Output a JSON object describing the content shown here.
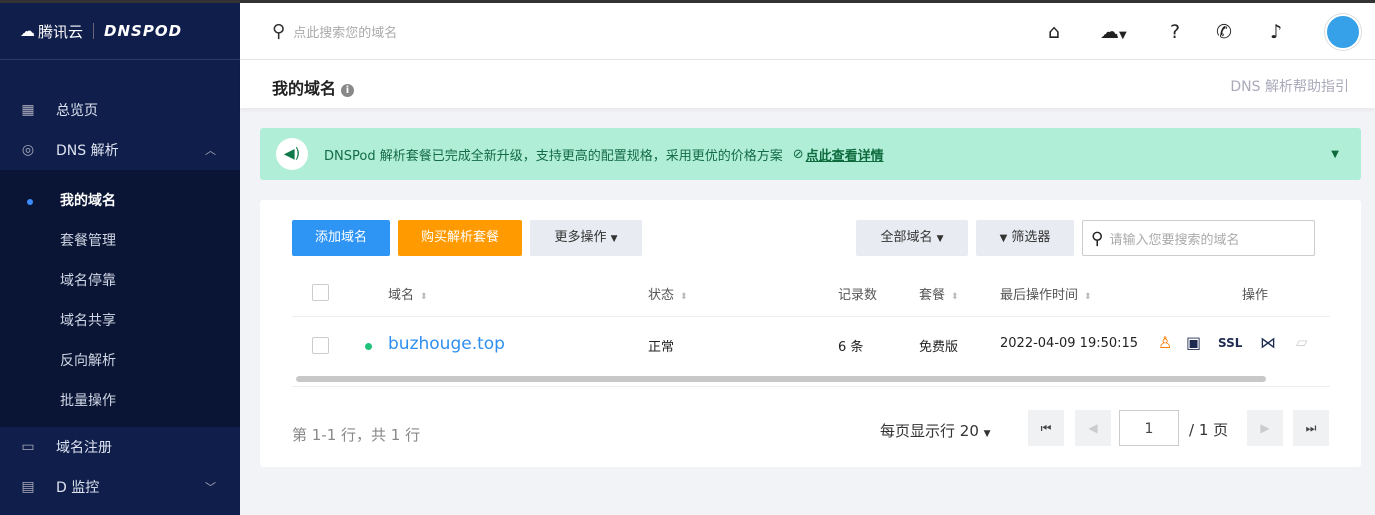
{
  "brand": {
    "cloud": "腾讯云",
    "product": "DNSPOD"
  },
  "sidebar": {
    "items": [
      {
        "label": "总览页"
      },
      {
        "label": "DNS 解析"
      },
      {
        "label": "域名注册"
      },
      {
        "label": "D 监控"
      }
    ],
    "sub_items": [
      {
        "label": "我的域名"
      },
      {
        "label": "套餐管理"
      },
      {
        "label": "域名停靠"
      },
      {
        "label": "域名共享"
      },
      {
        "label": "反向解析"
      },
      {
        "label": "批量操作"
      }
    ]
  },
  "header": {
    "search_placeholder": "点此搜索您的域名"
  },
  "page": {
    "title": "我的域名",
    "help_link": "DNS 解析帮助指引"
  },
  "notice": {
    "text": "DNSPod 解析套餐已完成全新升级，支持更高的配置规格，采用更优的价格方案",
    "link": "点此查看详情"
  },
  "toolbar": {
    "add": "添加域名",
    "buy": "购买解析套餐",
    "more": "更多操作",
    "all_domains": "全部域名",
    "filter": "筛选器",
    "search_placeholder": "请输入您要搜索的域名"
  },
  "table": {
    "headers": [
      "域名",
      "状态",
      "记录数",
      "套餐",
      "最后操作时间",
      "操作"
    ],
    "rows": [
      {
        "domain": "buzhouge.top",
        "status": "正常",
        "records": "6 条",
        "plan": "免费版",
        "time": "2022-04-09 19:50:15",
        "ssl": "SSL"
      }
    ]
  },
  "pagination": {
    "summary": "第 1-1 行，共 1 行",
    "per_page_label": "每页显示行",
    "per_page": "20",
    "page": "1",
    "total": "/ 1 页"
  },
  "colors": {
    "sidebar": "#0f1e4a",
    "primary": "#2f95f5",
    "orange": "#ff9a00",
    "notice": "#b0eed7"
  }
}
